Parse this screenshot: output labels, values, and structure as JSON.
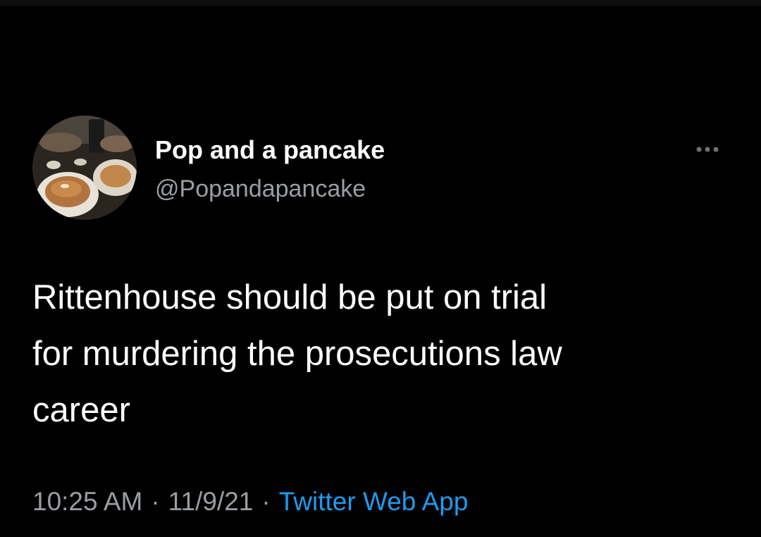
{
  "tweet": {
    "author": {
      "display_name": "Pop and a pancake",
      "handle": "@Popandapancake",
      "avatar_icon": "pancake-plate-photo"
    },
    "more_icon": "more-horizontal-icon",
    "text": "Rittenhouse should be put on trial\nfor murdering the prosecutions law\ncareer",
    "time": "10:25 AM",
    "date": "11/9/21",
    "separator": "·",
    "source": "Twitter Web App"
  },
  "colors": {
    "background": "#000000",
    "primary_text": "#ffffff",
    "secondary_text": "#9a9ea3",
    "link": "#1d9bf0"
  }
}
